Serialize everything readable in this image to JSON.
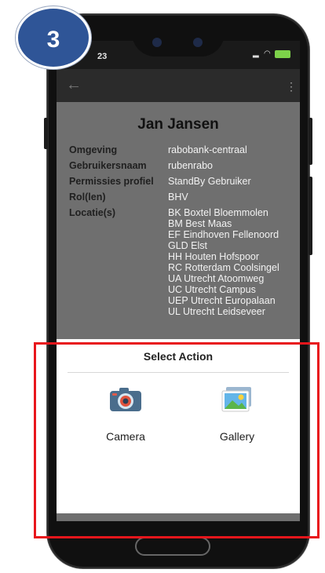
{
  "step": {
    "number": "3"
  },
  "status_bar": {
    "time": "23",
    "signal": "signal-icon",
    "wifi": "wifi-icon",
    "battery": "battery-icon"
  },
  "app_bar": {
    "back": "back-arrow-icon",
    "more": "more-vert-icon"
  },
  "profile": {
    "name": "Jan Jansen",
    "fields": [
      {
        "label": "Omgeving",
        "value": "rabobank-centraal"
      },
      {
        "label": "Gebruikersnaam",
        "value": "rubenrabo"
      },
      {
        "label": "Permissies profiel",
        "value": "StandBy Gebruiker"
      },
      {
        "label": "Rol(len)",
        "value": "BHV"
      }
    ],
    "locations_label": "Locatie(s)",
    "locations": [
      "BK Boxtel Bloemmolen",
      "BM Best Maas",
      "EF Eindhoven Fellenoord",
      "GLD Elst",
      "HH Houten Hofspoor",
      "RC Rotterdam Coolsingel",
      "UA Utrecht Atoomweg",
      "UC Utrecht Campus",
      "UEP Utrecht Europalaan",
      "UL Utrecht Leidseveer"
    ]
  },
  "dialog": {
    "title": "Select Action",
    "options": [
      {
        "label": "Camera",
        "icon": "camera-icon"
      },
      {
        "label": "Gallery",
        "icon": "gallery-icon"
      }
    ]
  },
  "colors": {
    "badge": "#2f5597",
    "highlight": "#e8161c",
    "dim": "#6f6f6f"
  }
}
